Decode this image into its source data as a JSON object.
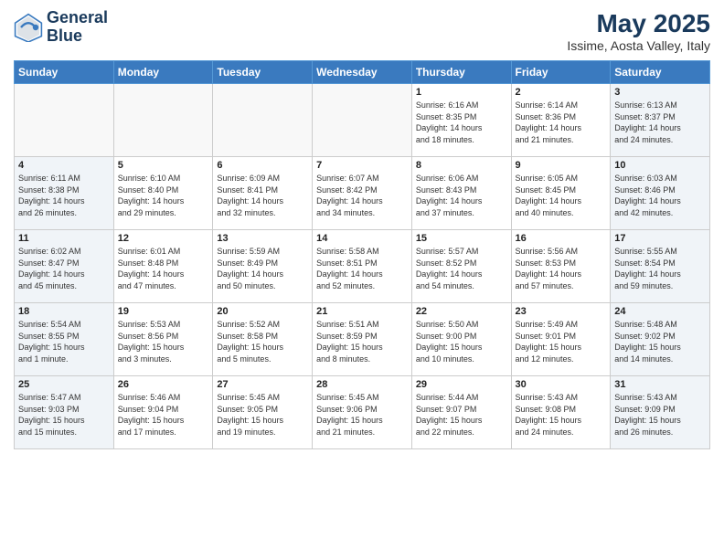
{
  "logo": {
    "line1": "General",
    "line2": "Blue"
  },
  "title": "May 2025",
  "location": "Issime, Aosta Valley, Italy",
  "weekdays": [
    "Sunday",
    "Monday",
    "Tuesday",
    "Wednesday",
    "Thursday",
    "Friday",
    "Saturday"
  ],
  "weeks": [
    [
      {
        "day": "",
        "info": ""
      },
      {
        "day": "",
        "info": ""
      },
      {
        "day": "",
        "info": ""
      },
      {
        "day": "",
        "info": ""
      },
      {
        "day": "1",
        "info": "Sunrise: 6:16 AM\nSunset: 8:35 PM\nDaylight: 14 hours\nand 18 minutes."
      },
      {
        "day": "2",
        "info": "Sunrise: 6:14 AM\nSunset: 8:36 PM\nDaylight: 14 hours\nand 21 minutes."
      },
      {
        "day": "3",
        "info": "Sunrise: 6:13 AM\nSunset: 8:37 PM\nDaylight: 14 hours\nand 24 minutes."
      }
    ],
    [
      {
        "day": "4",
        "info": "Sunrise: 6:11 AM\nSunset: 8:38 PM\nDaylight: 14 hours\nand 26 minutes."
      },
      {
        "day": "5",
        "info": "Sunrise: 6:10 AM\nSunset: 8:40 PM\nDaylight: 14 hours\nand 29 minutes."
      },
      {
        "day": "6",
        "info": "Sunrise: 6:09 AM\nSunset: 8:41 PM\nDaylight: 14 hours\nand 32 minutes."
      },
      {
        "day": "7",
        "info": "Sunrise: 6:07 AM\nSunset: 8:42 PM\nDaylight: 14 hours\nand 34 minutes."
      },
      {
        "day": "8",
        "info": "Sunrise: 6:06 AM\nSunset: 8:43 PM\nDaylight: 14 hours\nand 37 minutes."
      },
      {
        "day": "9",
        "info": "Sunrise: 6:05 AM\nSunset: 8:45 PM\nDaylight: 14 hours\nand 40 minutes."
      },
      {
        "day": "10",
        "info": "Sunrise: 6:03 AM\nSunset: 8:46 PM\nDaylight: 14 hours\nand 42 minutes."
      }
    ],
    [
      {
        "day": "11",
        "info": "Sunrise: 6:02 AM\nSunset: 8:47 PM\nDaylight: 14 hours\nand 45 minutes."
      },
      {
        "day": "12",
        "info": "Sunrise: 6:01 AM\nSunset: 8:48 PM\nDaylight: 14 hours\nand 47 minutes."
      },
      {
        "day": "13",
        "info": "Sunrise: 5:59 AM\nSunset: 8:49 PM\nDaylight: 14 hours\nand 50 minutes."
      },
      {
        "day": "14",
        "info": "Sunrise: 5:58 AM\nSunset: 8:51 PM\nDaylight: 14 hours\nand 52 minutes."
      },
      {
        "day": "15",
        "info": "Sunrise: 5:57 AM\nSunset: 8:52 PM\nDaylight: 14 hours\nand 54 minutes."
      },
      {
        "day": "16",
        "info": "Sunrise: 5:56 AM\nSunset: 8:53 PM\nDaylight: 14 hours\nand 57 minutes."
      },
      {
        "day": "17",
        "info": "Sunrise: 5:55 AM\nSunset: 8:54 PM\nDaylight: 14 hours\nand 59 minutes."
      }
    ],
    [
      {
        "day": "18",
        "info": "Sunrise: 5:54 AM\nSunset: 8:55 PM\nDaylight: 15 hours\nand 1 minute."
      },
      {
        "day": "19",
        "info": "Sunrise: 5:53 AM\nSunset: 8:56 PM\nDaylight: 15 hours\nand 3 minutes."
      },
      {
        "day": "20",
        "info": "Sunrise: 5:52 AM\nSunset: 8:58 PM\nDaylight: 15 hours\nand 5 minutes."
      },
      {
        "day": "21",
        "info": "Sunrise: 5:51 AM\nSunset: 8:59 PM\nDaylight: 15 hours\nand 8 minutes."
      },
      {
        "day": "22",
        "info": "Sunrise: 5:50 AM\nSunset: 9:00 PM\nDaylight: 15 hours\nand 10 minutes."
      },
      {
        "day": "23",
        "info": "Sunrise: 5:49 AM\nSunset: 9:01 PM\nDaylight: 15 hours\nand 12 minutes."
      },
      {
        "day": "24",
        "info": "Sunrise: 5:48 AM\nSunset: 9:02 PM\nDaylight: 15 hours\nand 14 minutes."
      }
    ],
    [
      {
        "day": "25",
        "info": "Sunrise: 5:47 AM\nSunset: 9:03 PM\nDaylight: 15 hours\nand 15 minutes."
      },
      {
        "day": "26",
        "info": "Sunrise: 5:46 AM\nSunset: 9:04 PM\nDaylight: 15 hours\nand 17 minutes."
      },
      {
        "day": "27",
        "info": "Sunrise: 5:45 AM\nSunset: 9:05 PM\nDaylight: 15 hours\nand 19 minutes."
      },
      {
        "day": "28",
        "info": "Sunrise: 5:45 AM\nSunset: 9:06 PM\nDaylight: 15 hours\nand 21 minutes."
      },
      {
        "day": "29",
        "info": "Sunrise: 5:44 AM\nSunset: 9:07 PM\nDaylight: 15 hours\nand 22 minutes."
      },
      {
        "day": "30",
        "info": "Sunrise: 5:43 AM\nSunset: 9:08 PM\nDaylight: 15 hours\nand 24 minutes."
      },
      {
        "day": "31",
        "info": "Sunrise: 5:43 AM\nSunset: 9:09 PM\nDaylight: 15 hours\nand 26 minutes."
      }
    ]
  ]
}
